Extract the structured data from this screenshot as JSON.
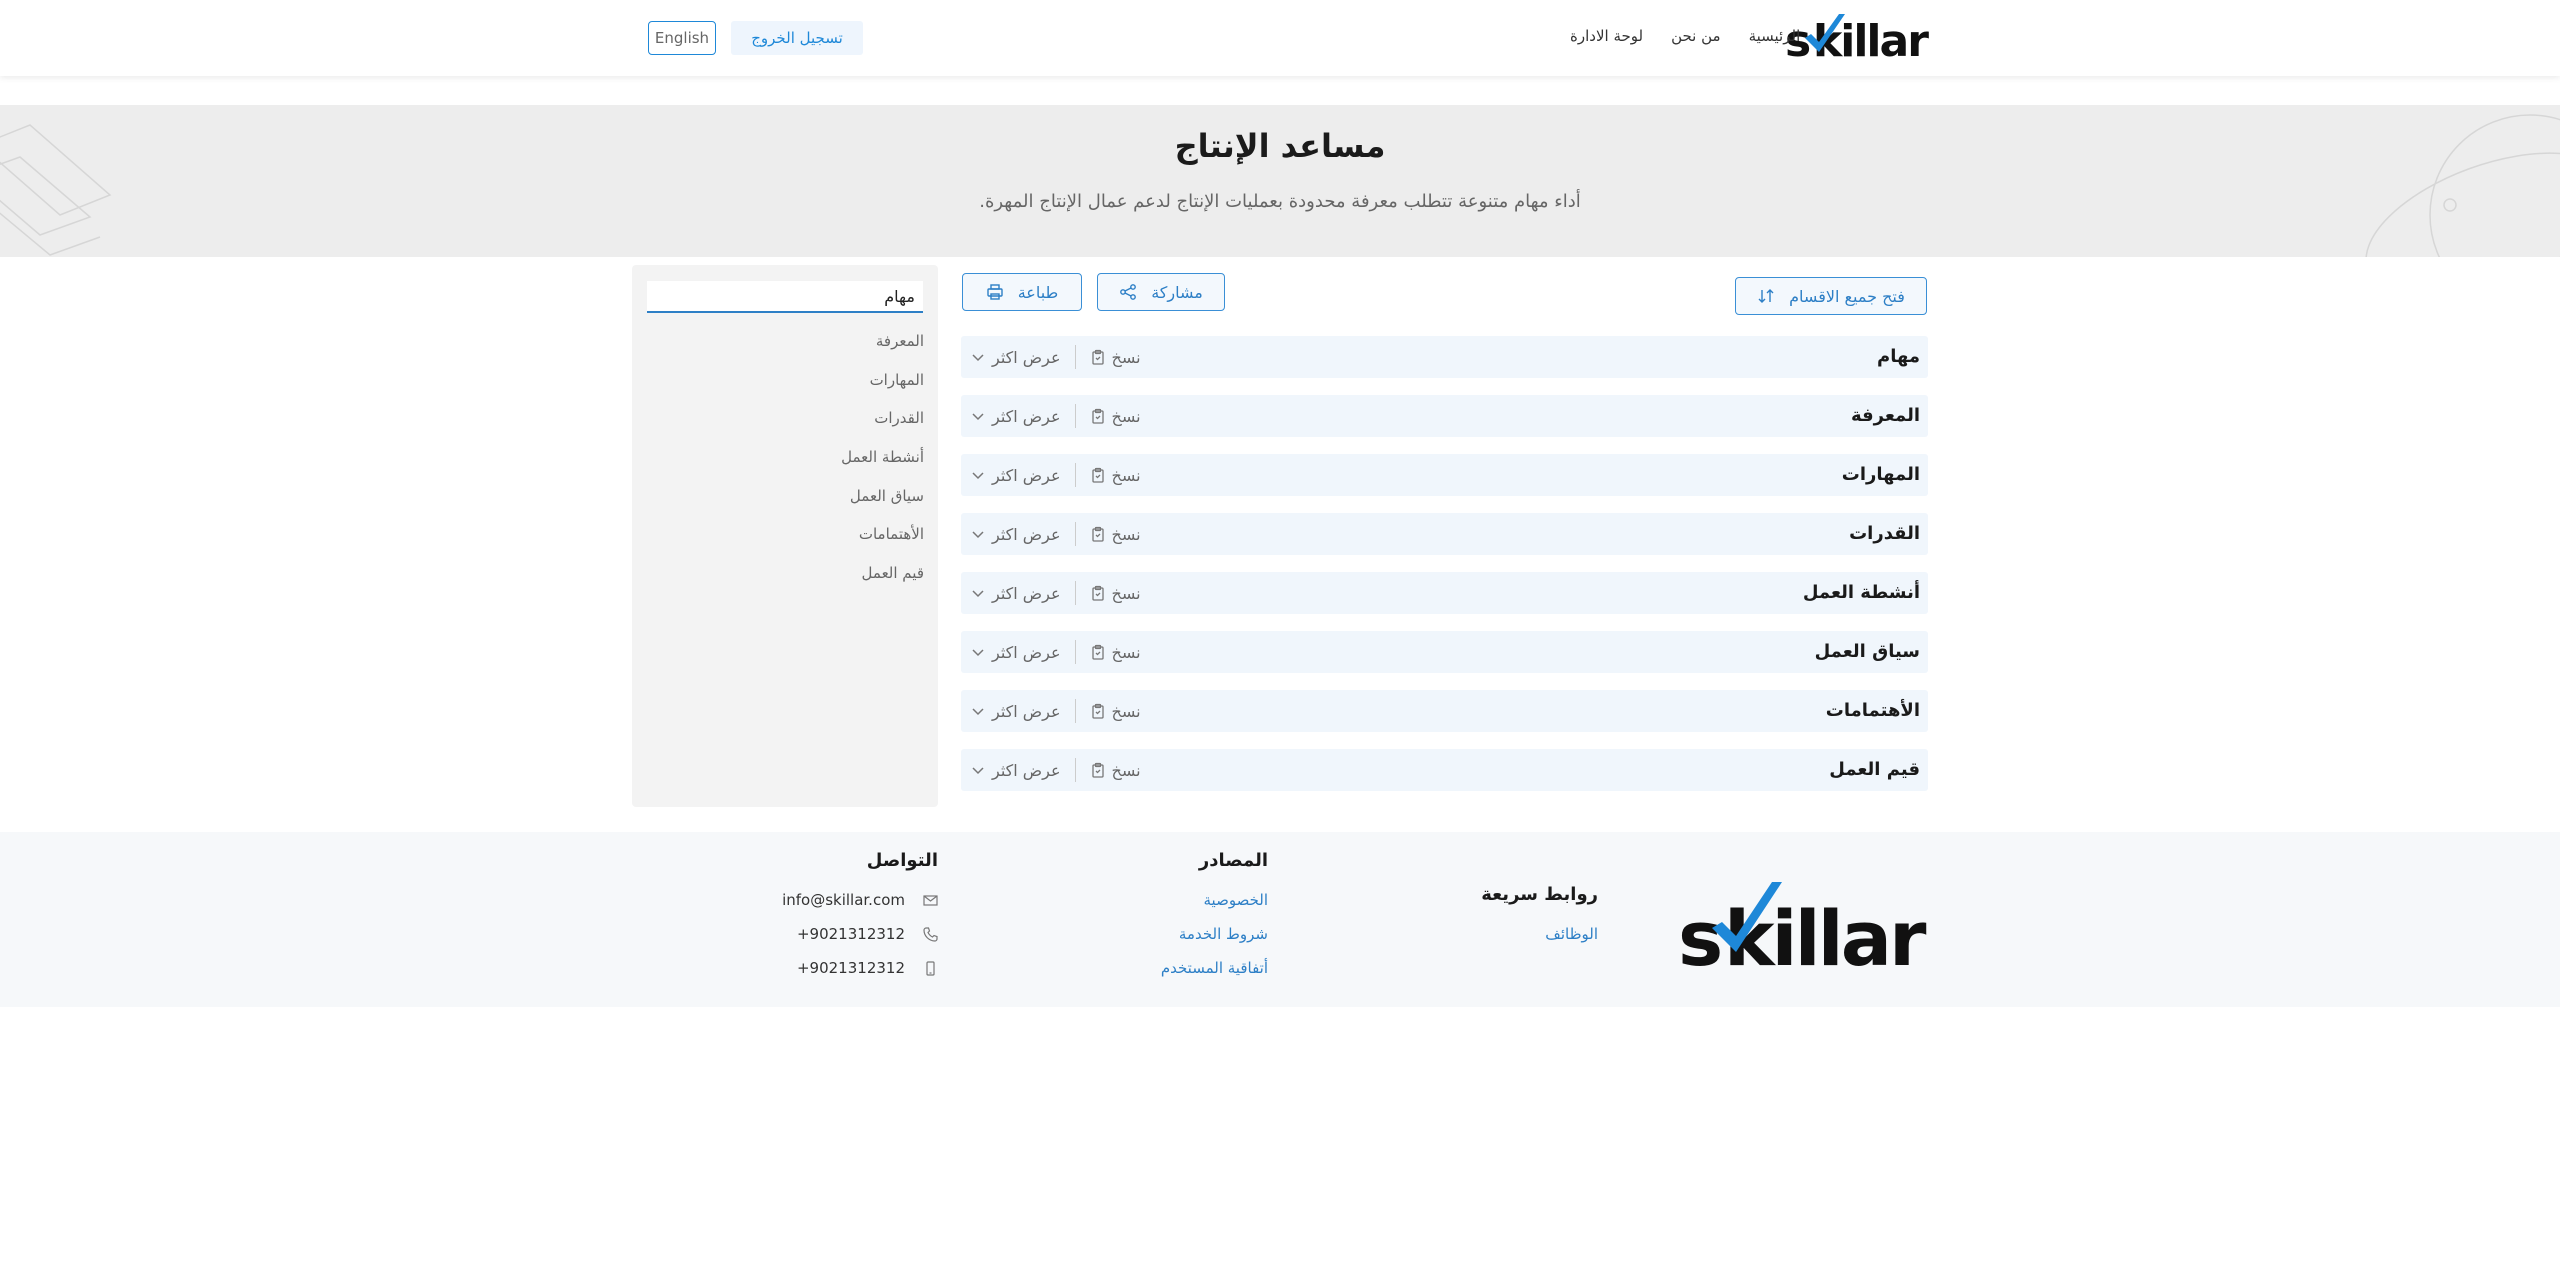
{
  "header": {
    "logo_text": "skillar",
    "nav": [
      "الرئيسية",
      "من نحن",
      "لوحة الادارة"
    ],
    "logout_label": "تسجيل الخروج",
    "language_label": "English"
  },
  "hero": {
    "title": "مساعد الإنتاج",
    "subtitle": "أداء مهام متنوعة تتطلب معرفة محدودة بعمليات الإنتاج لدعم عمال الإنتاج المهرة."
  },
  "actions": {
    "expand_all": "فتح جميع الاقسام",
    "share": "مشاركة",
    "print": "طباعة"
  },
  "row_controls": {
    "copy_label": "نسخ",
    "more_label": "عرض اكثر"
  },
  "sections": [
    "مهام",
    "المعرفة",
    "المهارات",
    "القدرات",
    "أنشطة العمل",
    "سياق العمل",
    "الأهتمامات",
    "قيم العمل"
  ],
  "sidebar": {
    "search_value": "مهام",
    "items": [
      "المعرفة",
      "المهارات",
      "القدرات",
      "أنشطة العمل",
      "سياق العمل",
      "الأهتمامات",
      "قيم العمل"
    ]
  },
  "footer": {
    "logo_text": "skillar",
    "quick_links_title": "روابط سريعة",
    "quick_links": [
      "الوظائف"
    ],
    "resources_title": "المصادر",
    "resources": [
      "الخصوصية",
      "شروط الخدمة",
      "أتفاقية المستخدم"
    ],
    "contact_title": "التواصل",
    "email": "info@skillar.com",
    "phone": "+9021312312",
    "mobile": "+9021312312"
  },
  "colors": {
    "accent": "#2d7fc6",
    "logo_check": "#1e88d8",
    "hero_bg": "#ededed",
    "row_bg": "#f0f6fc"
  }
}
